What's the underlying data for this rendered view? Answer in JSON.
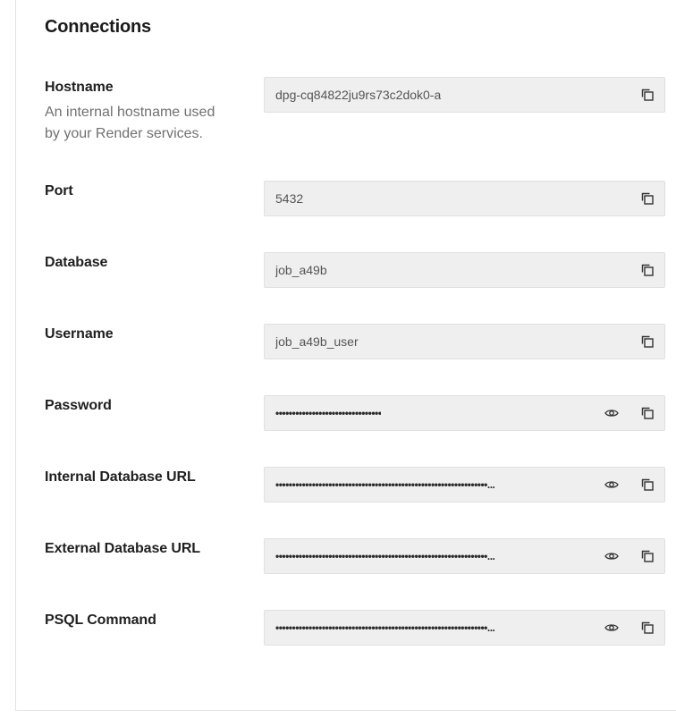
{
  "section": {
    "title": "Connections"
  },
  "fields": [
    {
      "label": "Hostname",
      "description": "An internal hostname used by your Render services.",
      "value": "dpg-cq84822ju9rs73c2dok0-a",
      "masked": false
    },
    {
      "label": "Port",
      "value": "5432",
      "masked": false
    },
    {
      "label": "Database",
      "value": "job_a49b",
      "masked": false
    },
    {
      "label": "Username",
      "value": "job_a49b_user",
      "masked": false
    },
    {
      "label": "Password",
      "value": "••••••••••••••••••••••••••••••••",
      "masked": true
    },
    {
      "label": "Internal Database URL",
      "value": "••••••••••••••••••••••••••••••••••••••••••••••••••••••••••••••••...",
      "masked": true
    },
    {
      "label": "External Database URL",
      "value": "••••••••••••••••••••••••••••••••••••••••••••••••••••••••••••••••...",
      "masked": true
    },
    {
      "label": "PSQL Command",
      "value": "••••••••••••••••••••••••••••••••••••••••••••••••••••••••••••••••...",
      "masked": true
    }
  ],
  "icons": {
    "copy": "copy-icon",
    "reveal": "eye-icon"
  },
  "colors": {
    "field_bg": "#efefef",
    "field_border": "#e0e0e0",
    "label": "#1f1f1f",
    "description": "#707070"
  }
}
